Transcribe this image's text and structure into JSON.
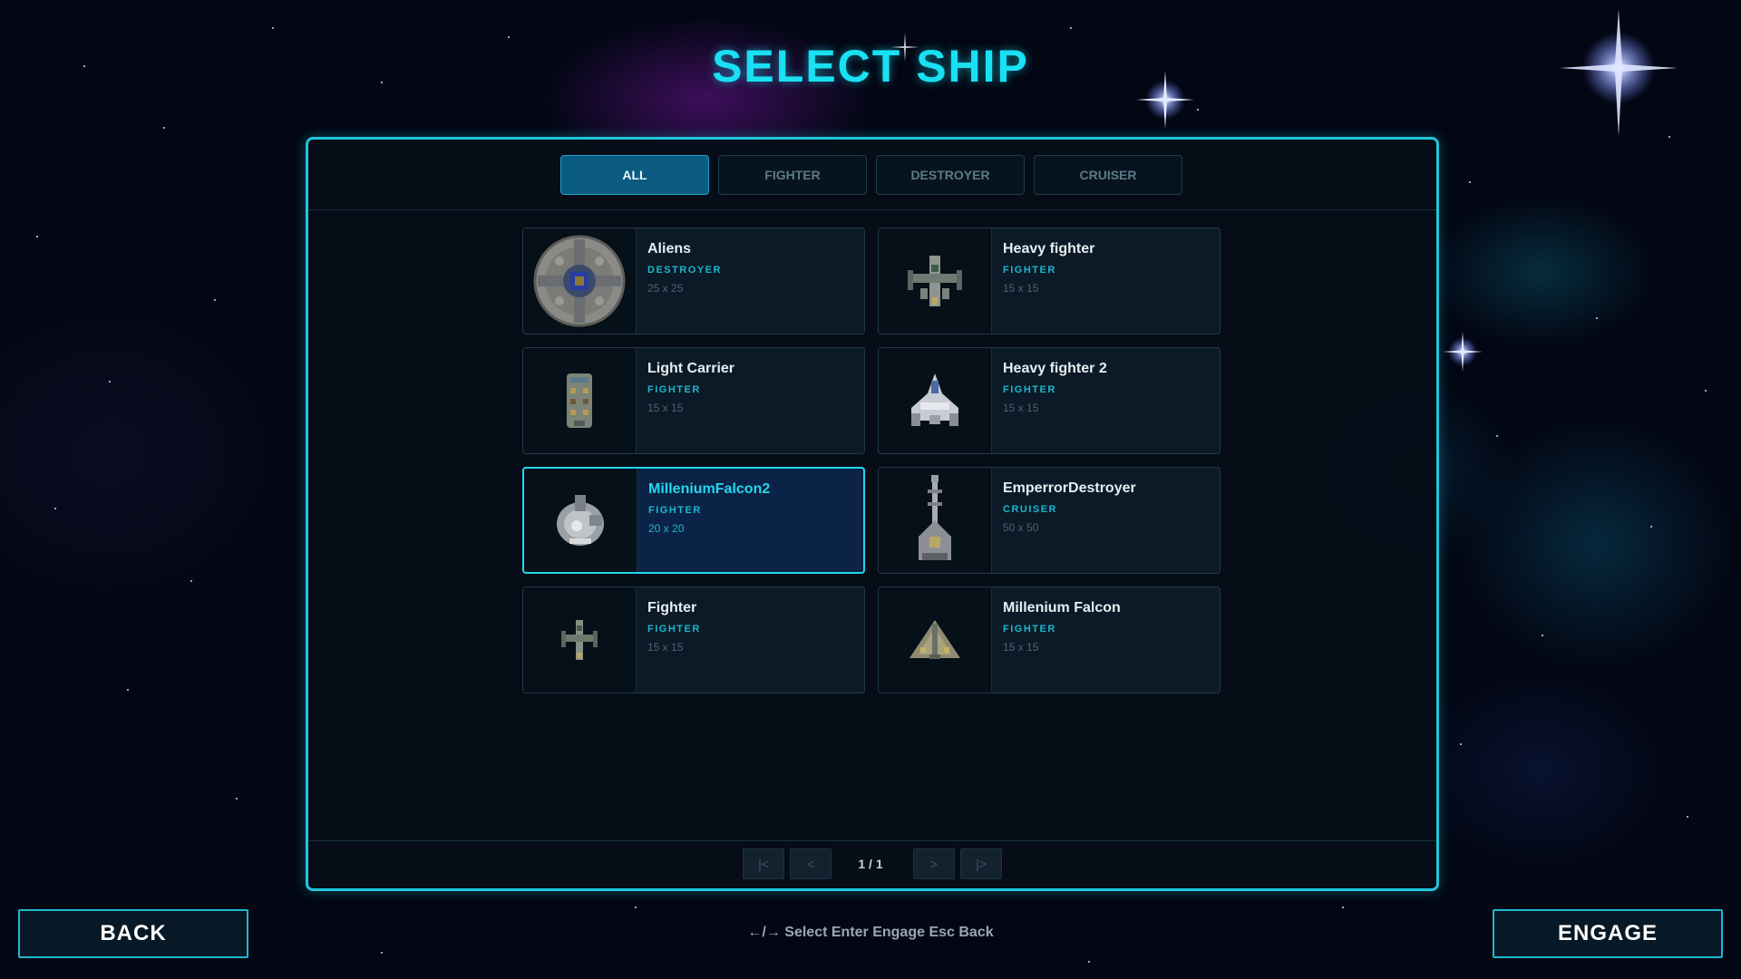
{
  "screen": {
    "title": "SELECT SHIP"
  },
  "tabs": [
    {
      "label": "ALL",
      "active": true
    },
    {
      "label": "FIGHTER",
      "active": false
    },
    {
      "label": "DESTROYER",
      "active": false
    },
    {
      "label": "CRUISER",
      "active": false
    }
  ],
  "ships": [
    {
      "name": "Aliens",
      "type": "DESTROYER",
      "size": "25 x 25",
      "icon": "alien-disc-ship-icon",
      "selected": false
    },
    {
      "name": "Heavy fighter",
      "type": "FIGHTER",
      "size": "15 x 15",
      "icon": "heavy-fighter-ship-icon",
      "selected": false
    },
    {
      "name": "Light Carrier",
      "type": "FIGHTER",
      "size": "15 x 15",
      "icon": "light-carrier-ship-icon",
      "selected": false
    },
    {
      "name": "Heavy fighter 2",
      "type": "FIGHTER",
      "size": "15 x 15",
      "icon": "heavy-fighter-2-ship-icon",
      "selected": false
    },
    {
      "name": "MilleniumFalcon2",
      "type": "FIGHTER",
      "size": "20 x 20",
      "icon": "millenium-falcon-2-ship-icon",
      "selected": true
    },
    {
      "name": "EmperrorDestroyer",
      "type": "CRUISER",
      "size": "50 x 50",
      "icon": "emperor-destroyer-ship-icon",
      "selected": false
    },
    {
      "name": "Fighter",
      "type": "FIGHTER",
      "size": "15 x 15",
      "icon": "fighter-ship-icon",
      "selected": false
    },
    {
      "name": "Millenium Falcon",
      "type": "FIGHTER",
      "size": "15 x 15",
      "icon": "millenium-falcon-ship-icon",
      "selected": false
    }
  ],
  "pager": {
    "first": "|<",
    "prev": "<",
    "page": "1 / 1",
    "next": ">",
    "last": "|>"
  },
  "footer": {
    "back_label": "BACK",
    "engage_label": "ENGAGE",
    "hint": "←/→ Select Enter Engage Esc Back"
  },
  "colors": {
    "accent": "#1fc6dc",
    "title": "#19e0f2",
    "active_tab": "#0b5a80",
    "selected_card": "#0b2346",
    "type_label": "#1bb8cf"
  }
}
